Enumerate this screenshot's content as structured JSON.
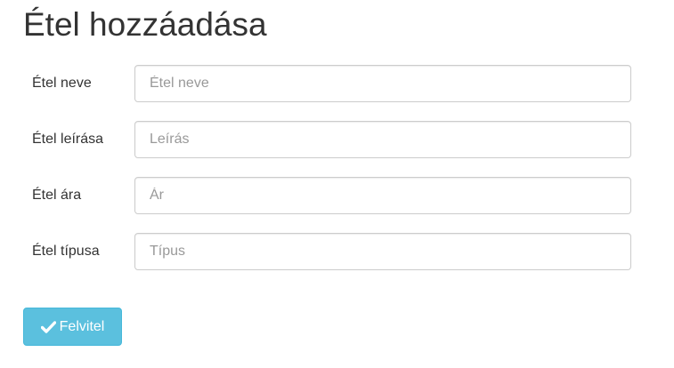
{
  "page": {
    "title": "Étel hozzáadása"
  },
  "form": {
    "fields": [
      {
        "label": "Étel neve",
        "placeholder": "Étel neve",
        "value": ""
      },
      {
        "label": "Étel leírása",
        "placeholder": "Leírás",
        "value": ""
      },
      {
        "label": "Étel ára",
        "placeholder": "Ár",
        "value": ""
      },
      {
        "label": "Étel típusa",
        "placeholder": "Típus",
        "value": ""
      }
    ],
    "submit": {
      "label": "Felvitel",
      "icon": "check-icon"
    }
  },
  "colors": {
    "button_background": "#5bc0de",
    "button_border": "#46b8da",
    "input_border": "#cccccc",
    "text": "#333333",
    "placeholder": "#999999"
  }
}
